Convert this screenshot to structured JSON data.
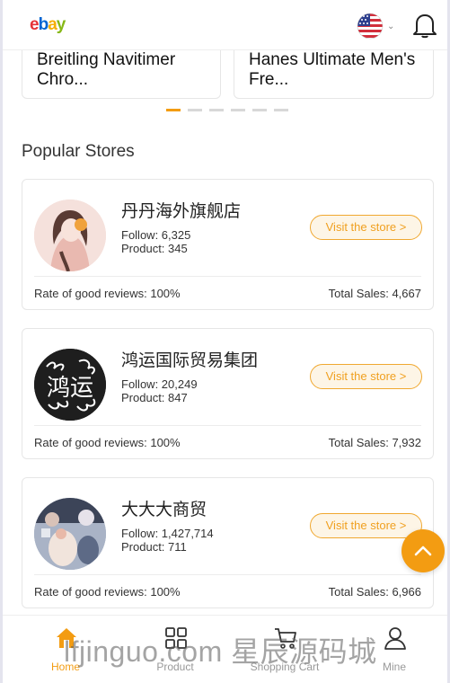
{
  "header": {
    "logo": [
      "e",
      "b",
      "a",
      "y"
    ],
    "region_icon": "us-flag-icon",
    "notification_icon": "bell-icon"
  },
  "products": [
    {
      "title": "Breitling Navitimer Chro..."
    },
    {
      "title": "Hanes Ultimate Men's Fre..."
    }
  ],
  "carousel": {
    "pages": 6,
    "active": 0
  },
  "section_title": "Popular Stores",
  "stores": [
    {
      "name": "丹丹海外旗舰店",
      "follow": "Follow: 6,325",
      "product": "Product: 345",
      "visit_label": "Visit the store  >",
      "rate": "Rate of good reviews: 100%",
      "sales": "Total Sales: 4,667"
    },
    {
      "name": "鸿运国际贸易集团",
      "follow": "Follow: 20,249",
      "product": "Product: 847",
      "visit_label": "Visit the store  >",
      "rate": "Rate of good reviews: 100%",
      "sales": "Total Sales: 7,932",
      "avatar_text": "鸿运"
    },
    {
      "name": "大大大商贸",
      "follow": "Follow: 1,427,714",
      "product": "Product: 711",
      "visit_label": "Visit the store  >",
      "rate": "Rate of good reviews: 100%",
      "sales": "Total Sales: 6,966"
    }
  ],
  "bottom_nav": [
    {
      "label": "Home",
      "icon": "home-icon",
      "active": true
    },
    {
      "label": "Product",
      "icon": "grid-icon",
      "active": false
    },
    {
      "label": "Shopping Cart",
      "icon": "cart-icon",
      "active": false
    },
    {
      "label": "Mine",
      "icon": "user-icon",
      "active": false
    }
  ],
  "watermark": "lfjinguo.com 星辰源码城",
  "colors": {
    "accent": "#f39c12",
    "button_bg": "#fdf5e6"
  }
}
